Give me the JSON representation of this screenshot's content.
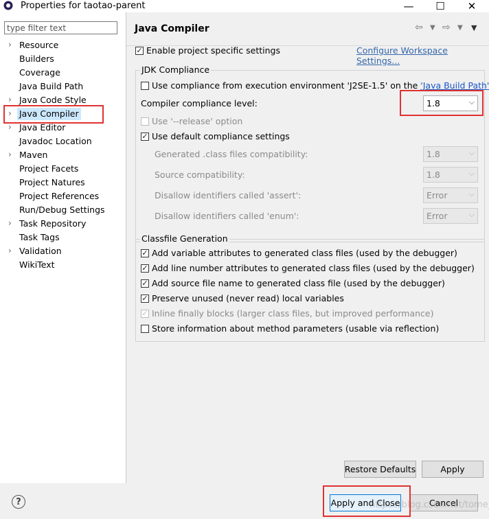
{
  "window": {
    "title": "Properties for taotao-parent",
    "minimize_glyph": "—",
    "maximize_glyph": "☐",
    "close_glyph": "✕"
  },
  "sidebar": {
    "filter_placeholder": "type filter text",
    "items": [
      {
        "label": "Resource",
        "expandable": true
      },
      {
        "label": "Builders",
        "expandable": false
      },
      {
        "label": "Coverage",
        "expandable": false
      },
      {
        "label": "Java Build Path",
        "expandable": false
      },
      {
        "label": "Java Code Style",
        "expandable": true
      },
      {
        "label": "Java Compiler",
        "expandable": true,
        "selected": true
      },
      {
        "label": "Java Editor",
        "expandable": true
      },
      {
        "label": "Javadoc Location",
        "expandable": false
      },
      {
        "label": "Maven",
        "expandable": true
      },
      {
        "label": "Project Facets",
        "expandable": false
      },
      {
        "label": "Project Natures",
        "expandable": false
      },
      {
        "label": "Project References",
        "expandable": false
      },
      {
        "label": "Run/Debug Settings",
        "expandable": false
      },
      {
        "label": "Task Repository",
        "expandable": true
      },
      {
        "label": "Task Tags",
        "expandable": false
      },
      {
        "label": "Validation",
        "expandable": true
      },
      {
        "label": "WikiText",
        "expandable": false
      }
    ]
  },
  "page": {
    "title": "Java Compiler",
    "enable_specific": "Enable project specific settings",
    "configure_link": "Configure Workspace Settings...",
    "jdk_group": {
      "title": "JDK Compliance",
      "use_env_prefix": "Use compliance from execution environment 'J2SE-1.5' on the ",
      "use_env_link": "'Java Build Path'",
      "compliance_label": "Compiler compliance level:",
      "compliance_value": "1.8",
      "release_option": "Use '--release' option",
      "use_default": "Use default compliance settings",
      "generated_label": "Generated .class files compatibility:",
      "generated_value": "1.8",
      "source_label": "Source compatibility:",
      "source_value": "1.8",
      "assert_label": "Disallow identifiers called 'assert':",
      "assert_value": "Error",
      "enum_label": "Disallow identifiers called 'enum':",
      "enum_value": "Error"
    },
    "classfile_group": {
      "title": "Classfile Generation",
      "options": [
        {
          "label": "Add variable attributes to generated class files (used by the debugger)",
          "checked": true,
          "enabled": true
        },
        {
          "label": "Add line number attributes to generated class files (used by the debugger)",
          "checked": true,
          "enabled": true
        },
        {
          "label": "Add source file name to generated class file (used by the debugger)",
          "checked": true,
          "enabled": true
        },
        {
          "label": "Preserve unused (never read) local variables",
          "checked": true,
          "enabled": true
        },
        {
          "label": "Inline finally blocks (larger class files, but improved performance)",
          "checked": true,
          "enabled": false
        },
        {
          "label": "Store information about method parameters (usable via reflection)",
          "checked": false,
          "enabled": true
        }
      ]
    },
    "restore_defaults": "Restore Defaults",
    "apply": "Apply"
  },
  "footer": {
    "help": "?",
    "apply_close": "Apply and Close",
    "cancel": "Cancel",
    "watermark": "https://blog.csdn.net/tome_U"
  },
  "colors": {
    "highlight_box": "#e03131",
    "selection": "#cce8ff",
    "link": "#1a56c7"
  }
}
